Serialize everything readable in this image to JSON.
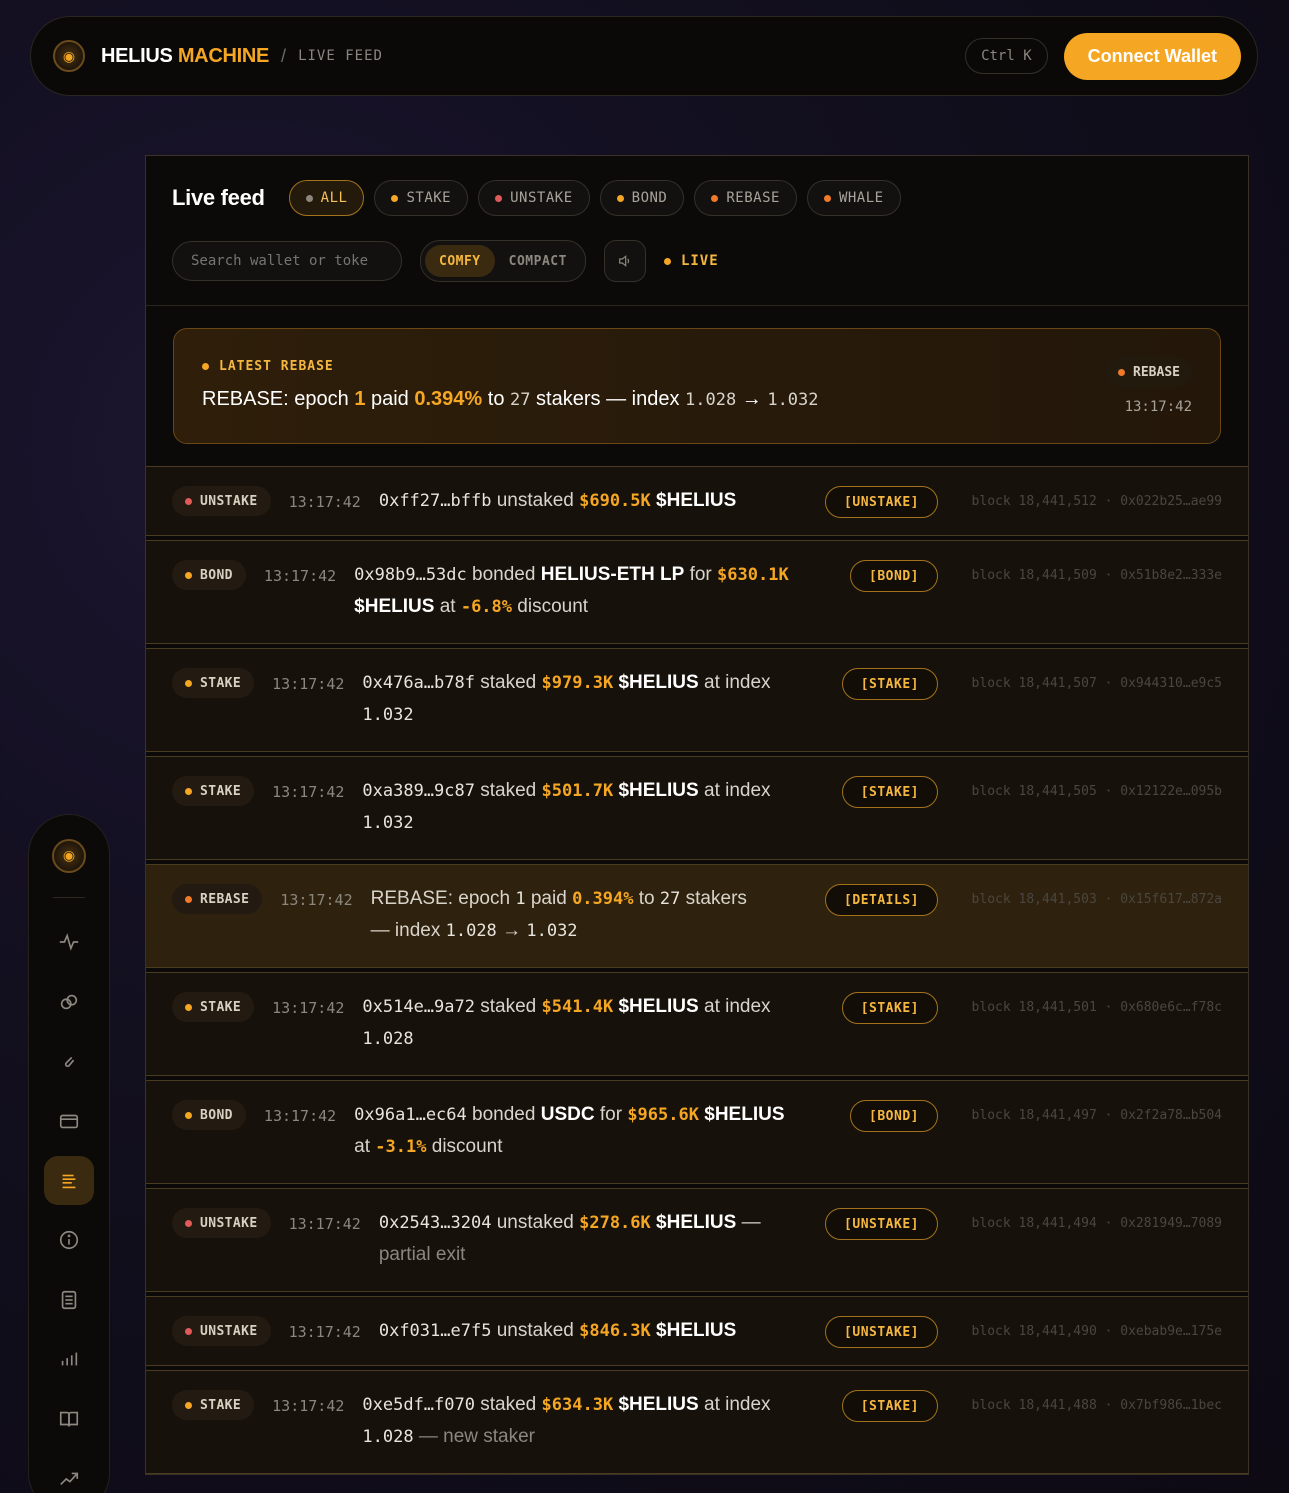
{
  "header": {
    "brand_part1": "HELIUS",
    "brand_part2": "MACHINE",
    "crumb_sep": "/",
    "crumb": "LIVE FEED",
    "shortcut": "Ctrl K",
    "connect_label": "Connect Wallet"
  },
  "feed": {
    "title": "Live feed",
    "filters": [
      {
        "label": "ALL",
        "color": "#8b877f",
        "active": true
      },
      {
        "label": "STAKE",
        "color": "#f5a623",
        "active": false
      },
      {
        "label": "UNSTAKE",
        "color": "#e05a5a",
        "active": false
      },
      {
        "label": "BOND",
        "color": "#f5a623",
        "active": false
      },
      {
        "label": "REBASE",
        "color": "#f07a2a",
        "active": false
      },
      {
        "label": "WHALE",
        "color": "#f07a2a",
        "active": false
      }
    ],
    "search_placeholder": "Search wallet or toke",
    "density": {
      "comfy": "COMFY",
      "compact": "COMPACT"
    },
    "live_label": "LIVE"
  },
  "latest": {
    "tag": "LATEST REBASE",
    "text_a": "REBASE: epoch ",
    "epoch": "1",
    "text_b": " paid ",
    "pct": "0.394%",
    "text_c": " to ",
    "stakers": "27",
    "text_d": " stakers — index ",
    "idx_from": "1.028",
    "arrow": " → ",
    "idx_to": "1.032",
    "badge": "REBASE",
    "time": "13:17:42"
  },
  "rows": [
    {
      "type": "UNSTAKE",
      "color": "#e05a5a",
      "time": "13:17:42",
      "addr": "0xff27…bffb",
      "verb": " unstaked ",
      "amt": "$690.5K",
      "tok": " $HELIUS",
      "tail": "",
      "tail2": "",
      "action": "[UNSTAKE]",
      "meta": "block 18,441,512 · 0x022b25…ae99"
    },
    {
      "type": "BOND",
      "color": "#f5a623",
      "time": "13:17:42",
      "addr": "0x98b9…53dc",
      "verb": " bonded ",
      "asset": "HELIUS-ETH LP",
      "for": " for ",
      "amt": "$630.1K",
      "tok": " $HELIUS",
      "at": " at ",
      "disc": "-6.8%",
      "disc_tail": " discount",
      "action": "[BOND]",
      "meta": "block 18,441,509 · 0x51b8e2…333e"
    },
    {
      "type": "STAKE",
      "color": "#f5a623",
      "time": "13:17:42",
      "addr": "0x476a…b78f",
      "verb": " staked ",
      "amt": "$979.3K",
      "tok": " $HELIUS",
      "tail": " at index",
      "idx": "1.032",
      "tail2": "",
      "action": "[STAKE]",
      "meta": "block 18,441,507 · 0x944310…e9c5"
    },
    {
      "type": "STAKE",
      "color": "#f5a623",
      "time": "13:17:42",
      "addr": "0xa389…9c87",
      "verb": " staked ",
      "amt": "$501.7K",
      "tok": " $HELIUS",
      "tail": " at index",
      "idx": "1.032",
      "tail2": "",
      "action": "[STAKE]",
      "meta": "block 18,441,505 · 0x12122e…095b"
    },
    {
      "type": "REBASE",
      "color": "#f07a2a",
      "time": "13:17:42",
      "r1": "REBASE: epoch ",
      "epoch": "1",
      "r2": " paid ",
      "pct": "0.394%",
      "r3": " to ",
      "stakers": "27",
      "r4": " stakers",
      "r5": "— index ",
      "idx_from": "1.028",
      "arrow": " → ",
      "idx_to": "1.032",
      "action": "[DETAILS]",
      "meta": "block 18,441,503 · 0x15f617…872a"
    },
    {
      "type": "STAKE",
      "color": "#f5a623",
      "time": "13:17:42",
      "addr": "0x514e…9a72",
      "verb": " staked ",
      "amt": "$541.4K",
      "tok": " $HELIUS",
      "tail": " at index",
      "idx": "1.028",
      "tail2": "",
      "action": "[STAKE]",
      "meta": "block 18,441,501 · 0x680e6c…f78c"
    },
    {
      "type": "BOND",
      "color": "#f5a623",
      "time": "13:17:42",
      "addr": "0x96a1…ec64",
      "verb": " bonded ",
      "asset": "USDC",
      "for": " for ",
      "amt": "$965.6K",
      "tok": " $HELIUS",
      "at": "at ",
      "disc": "-3.1%",
      "disc_tail": " discount",
      "action": "[BOND]",
      "meta": "block 18,441,497 · 0x2f2a78…b504"
    },
    {
      "type": "UNSTAKE",
      "color": "#e05a5a",
      "time": "13:17:42",
      "addr": "0x2543…3204",
      "verb": " unstaked ",
      "amt": "$278.6K",
      "tok": " $HELIUS",
      "tail": " —",
      "tail2": "partial exit",
      "action": "[UNSTAKE]",
      "meta": "block 18,441,494 · 0x281949…7089"
    },
    {
      "type": "UNSTAKE",
      "color": "#e05a5a",
      "time": "13:17:42",
      "addr": "0xf031…e7f5",
      "verb": " unstaked ",
      "amt": "$846.3K",
      "tok": " $HELIUS",
      "tail": "",
      "tail2": "",
      "action": "[UNSTAKE]",
      "meta": "block 18,441,490 · 0xebab9e…175e"
    },
    {
      "type": "STAKE",
      "color": "#f5a623",
      "time": "13:17:42",
      "addr": "0xe5df…f070",
      "verb": " staked ",
      "amt": "$634.3K",
      "tok": " $HELIUS",
      "tail": " at index",
      "idx": "1.028",
      "tail2": " — new staker",
      "action": "[STAKE]",
      "meta": "block 18,441,488 · 0x7bf986…1bec"
    }
  ],
  "rail": {
    "items": [
      {
        "icon": "pulse-icon"
      },
      {
        "icon": "link-icon"
      },
      {
        "icon": "paperclip-icon"
      },
      {
        "icon": "wallet-icon"
      },
      {
        "icon": "feed-list-icon",
        "active": true
      },
      {
        "icon": "info-icon"
      },
      {
        "icon": "calculator-icon"
      },
      {
        "icon": "bar-chart-icon"
      },
      {
        "icon": "book-icon"
      },
      {
        "icon": "trend-icon"
      }
    ]
  }
}
